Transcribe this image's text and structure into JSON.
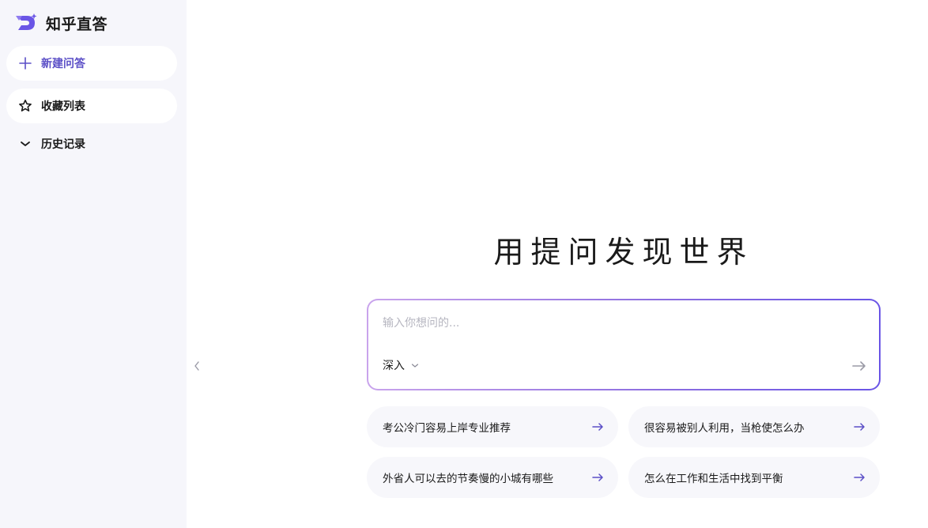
{
  "brand": {
    "name": "知乎直答",
    "accent_color": "#6a55e6",
    "logo_icon": "zhida-logo-icon"
  },
  "sidebar": {
    "items": [
      {
        "label": "新建问答",
        "icon": "plus-icon"
      },
      {
        "label": "收藏列表",
        "icon": "star-icon"
      },
      {
        "label": "历史记录",
        "icon": "chevron-down-icon"
      }
    ]
  },
  "main": {
    "title": "用提问发现世界",
    "composer": {
      "placeholder": "输入你想问的...",
      "value": "",
      "mode_label": "深入",
      "mode_icon": "chevron-down-icon",
      "send_icon": "arrow-right-icon"
    },
    "suggestions": [
      {
        "text": "考公冷门容易上岸专业推荐"
      },
      {
        "text": "很容易被别人利用，当枪使怎么办"
      },
      {
        "text": "外省人可以去的节奏慢的小城有哪些"
      },
      {
        "text": "怎么在工作和生活中找到平衡"
      }
    ]
  }
}
